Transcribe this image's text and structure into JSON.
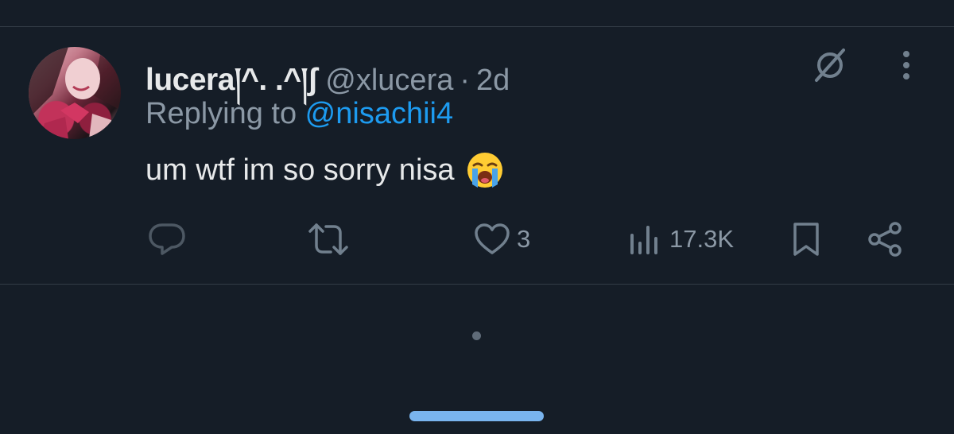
{
  "tweet": {
    "display_name": "lucera།^. .^།ʃ",
    "handle": "@xlucera",
    "separator": "·",
    "timestamp": "2d",
    "replying_prefix": "Replying to ",
    "replying_to": "@nisachii4",
    "text": "um wtf im so sorry nisa",
    "emoji": "loudly-crying-face"
  },
  "actions": {
    "reply": {
      "icon": "reply-icon",
      "count": ""
    },
    "retweet": {
      "icon": "retweet-icon",
      "count": ""
    },
    "like": {
      "icon": "heart-icon",
      "count": "3"
    },
    "views": {
      "icon": "views-icon",
      "count": "17.3K"
    },
    "bookmark": {
      "icon": "bookmark-icon"
    },
    "share": {
      "icon": "share-icon"
    }
  },
  "colors": {
    "background": "#151d27",
    "primary_text": "#e7e9ea",
    "secondary_text": "#8b98a5",
    "mention": "#1d9bf0",
    "icon": "#71808e",
    "home_indicator": "#79b4ee"
  }
}
